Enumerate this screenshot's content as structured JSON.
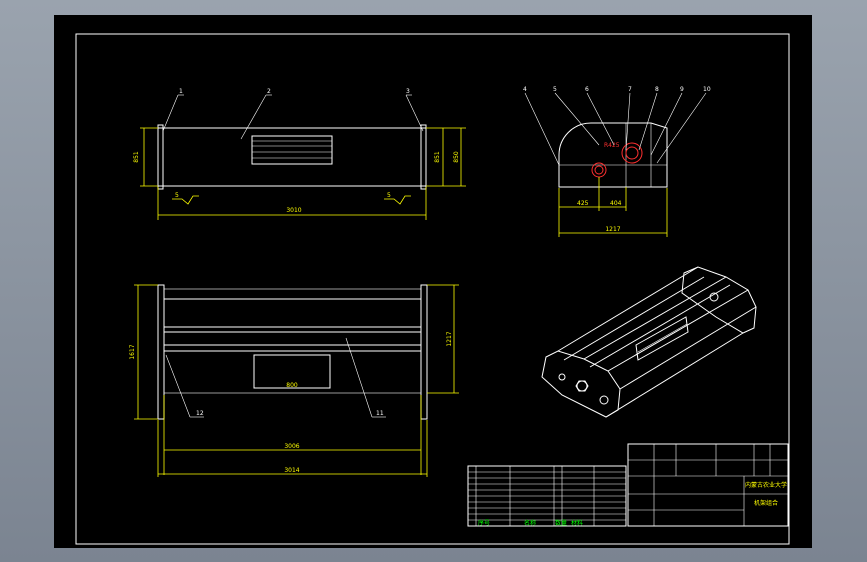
{
  "colors": {
    "background": "#000000",
    "outline": "#ffffff",
    "dimension": "#ffff00",
    "table_text": "#00ff00",
    "hidden_feature": "#ff3030"
  },
  "balloons": [
    "1",
    "2",
    "3",
    "4",
    "5",
    "6",
    "7",
    "8",
    "9",
    "10",
    "11",
    "12"
  ],
  "front_view": {
    "dim_overall": "3010",
    "dim_height_left": "851",
    "dim_height_right1": "851",
    "dim_height_right2": "850",
    "roughness_left": "5",
    "roughness_right": "5"
  },
  "side_view": {
    "dim_radius": "R425",
    "dim_a": "425",
    "dim_b": "404",
    "dim_width": "1217"
  },
  "top_view": {
    "dim_slot": "800",
    "dim_inner": "3006",
    "dim_outer": "3014",
    "dim_left": "1617",
    "dim_right": "1217"
  },
  "title_block": {
    "university": "内蒙古农业大学",
    "drawing_name": "机架组合",
    "row_labels": [
      "序号",
      "名称",
      "数量",
      "材料"
    ]
  }
}
